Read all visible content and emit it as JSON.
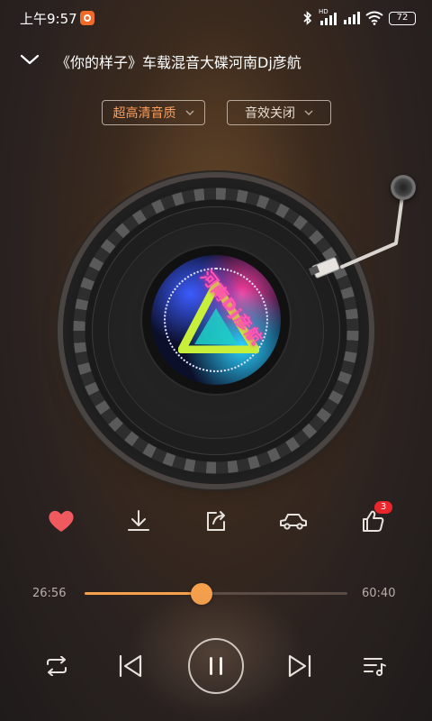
{
  "status_bar": {
    "time": "上午9:57",
    "hd_label": "HD",
    "battery": "72"
  },
  "header": {
    "song_title": "《你的样子》车载混音大碟河南Dj彦航",
    "quality_label": "超高清音质",
    "effect_label": "音效关闭"
  },
  "album_art": {
    "label_text": "河南Dj彦航"
  },
  "actions": {
    "like_count_badge": "3"
  },
  "progress": {
    "current_time": "26:56",
    "total_time": "60:40",
    "fraction": 0.444
  },
  "colors": {
    "accent": "#f7a04b",
    "quality_text": "#ff9d5a",
    "like_heart": "#f05a5f",
    "badge": "#e8262b"
  },
  "icons": {
    "collapse": "chevron-down-icon",
    "favorite": "heart-icon",
    "download": "download-icon",
    "share": "share-icon",
    "car_mode": "car-icon",
    "thumbs_up": "thumbs-up-icon",
    "repeat": "repeat-icon",
    "previous": "skip-previous-icon",
    "pause": "pause-icon",
    "next": "skip-next-icon",
    "playlist": "playlist-icon"
  }
}
